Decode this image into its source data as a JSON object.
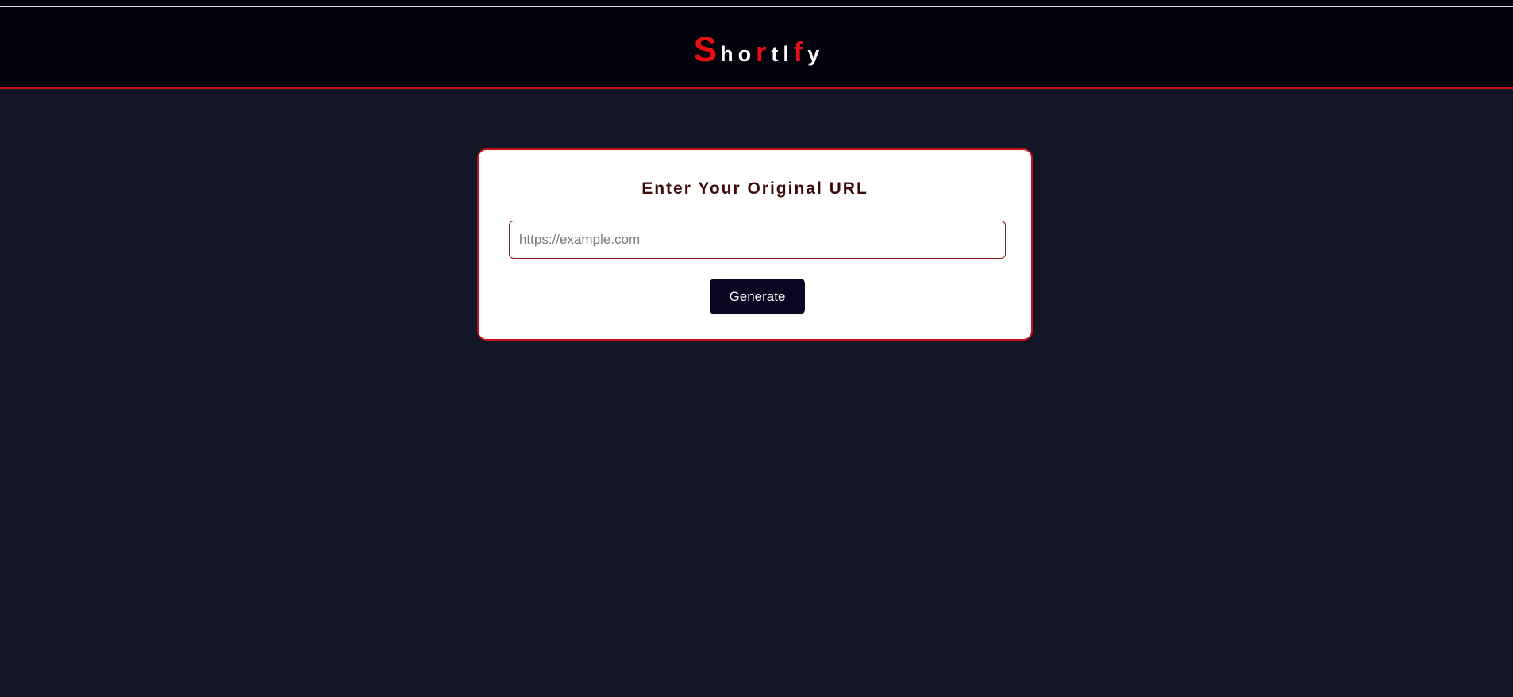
{
  "app": {
    "logo": {
      "letters": [
        "S",
        "h",
        "o",
        "r",
        "t",
        "l",
        "f",
        "y"
      ]
    }
  },
  "colors": {
    "background": "#131627",
    "header": "#02020d",
    "accent_red": "#e60f13",
    "card": "#ffffff",
    "button": "#0a0622"
  },
  "form": {
    "title": "Enter Your Original URL",
    "input_value": "",
    "input_placeholder": "https://example.com",
    "button_label": "Generate"
  }
}
